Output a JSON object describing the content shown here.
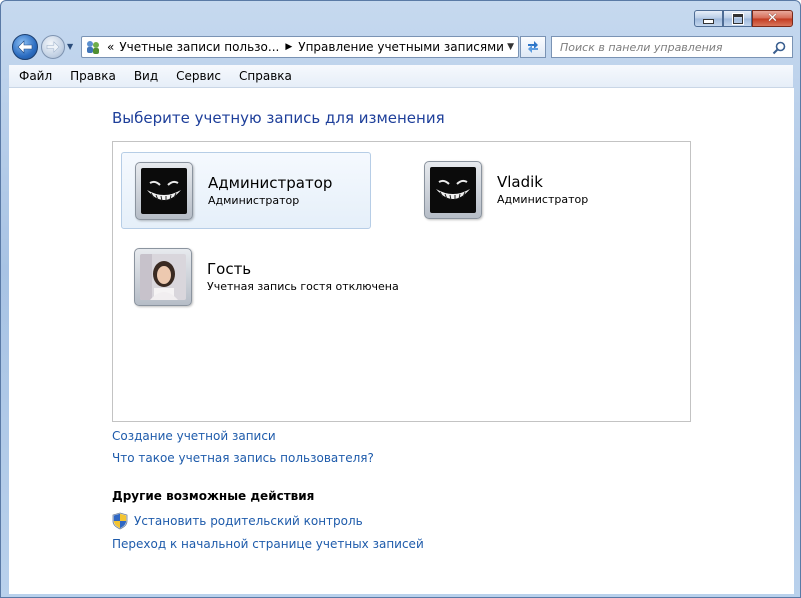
{
  "address_bar": {
    "crumb_prefix": "«",
    "crumb_1": "Учетные записи пользо...",
    "crumb_2": "Управление учетными записями"
  },
  "search": {
    "placeholder": "Поиск в панели управления"
  },
  "menu": [
    "Файл",
    "Правка",
    "Вид",
    "Сервис",
    "Справка"
  ],
  "page_title": "Выберите учетную запись для изменения",
  "accounts": [
    {
      "name": "Администратор",
      "role": "Администратор",
      "selected": true
    },
    {
      "name": "Vladik",
      "role": "Администратор",
      "selected": false
    },
    {
      "name": "Гость",
      "role": "Учетная запись гостя отключена",
      "selected": false
    }
  ],
  "links": {
    "create_account": "Создание учетной записи",
    "what_is_account": "Что такое учетная запись пользователя?"
  },
  "other_actions": {
    "heading": "Другие возможные действия",
    "parental_control": "Установить родительский контроль",
    "home_page": "Переход к начальной странице учетных записей"
  },
  "icons": {
    "back": "back-arrow-icon",
    "forward": "forward-arrow-icon",
    "refresh": "refresh-icon",
    "search": "search-icon",
    "shield": "uac-shield-icon"
  }
}
